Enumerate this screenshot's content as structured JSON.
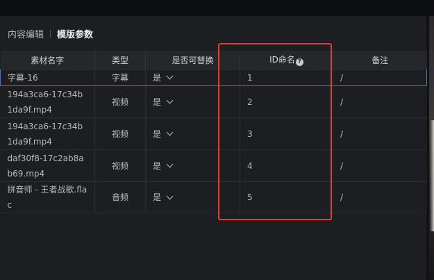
{
  "breadcrumb": {
    "parent": "内容编辑",
    "current": "模版参数"
  },
  "table": {
    "headers": {
      "name": "素材名字",
      "type": "类型",
      "replaceable": "是否可替换",
      "id_name": "ID命名",
      "note": "备注"
    },
    "help_glyph": "?",
    "rows": [
      {
        "name": "字幕-16",
        "type": "字幕",
        "replaceable": "是",
        "id": "1",
        "note": "/"
      },
      {
        "name": "194a3ca6-17c34b1da9f.mp4",
        "type": "视频",
        "replaceable": "是",
        "id": "2",
        "note": "/"
      },
      {
        "name": "194a3ca6-17c34b1da9f.mp4",
        "type": "视频",
        "replaceable": "是",
        "id": "3",
        "note": "/"
      },
      {
        "name": "daf30f8-17c2ab8ab69.mp4",
        "type": "视频",
        "replaceable": "是",
        "id": "4",
        "note": "/"
      },
      {
        "name": "拼音师 - 王者战歌.flac",
        "type": "音频",
        "replaceable": "是",
        "id": "5",
        "note": "/"
      }
    ]
  },
  "colors": {
    "selection_border": "#4a6fe0",
    "annotation_border": "#e0412f",
    "panel_background": "#1d1e21"
  },
  "icons": {
    "help": "question-circle-icon",
    "dropdown": "chevron-down-icon"
  }
}
